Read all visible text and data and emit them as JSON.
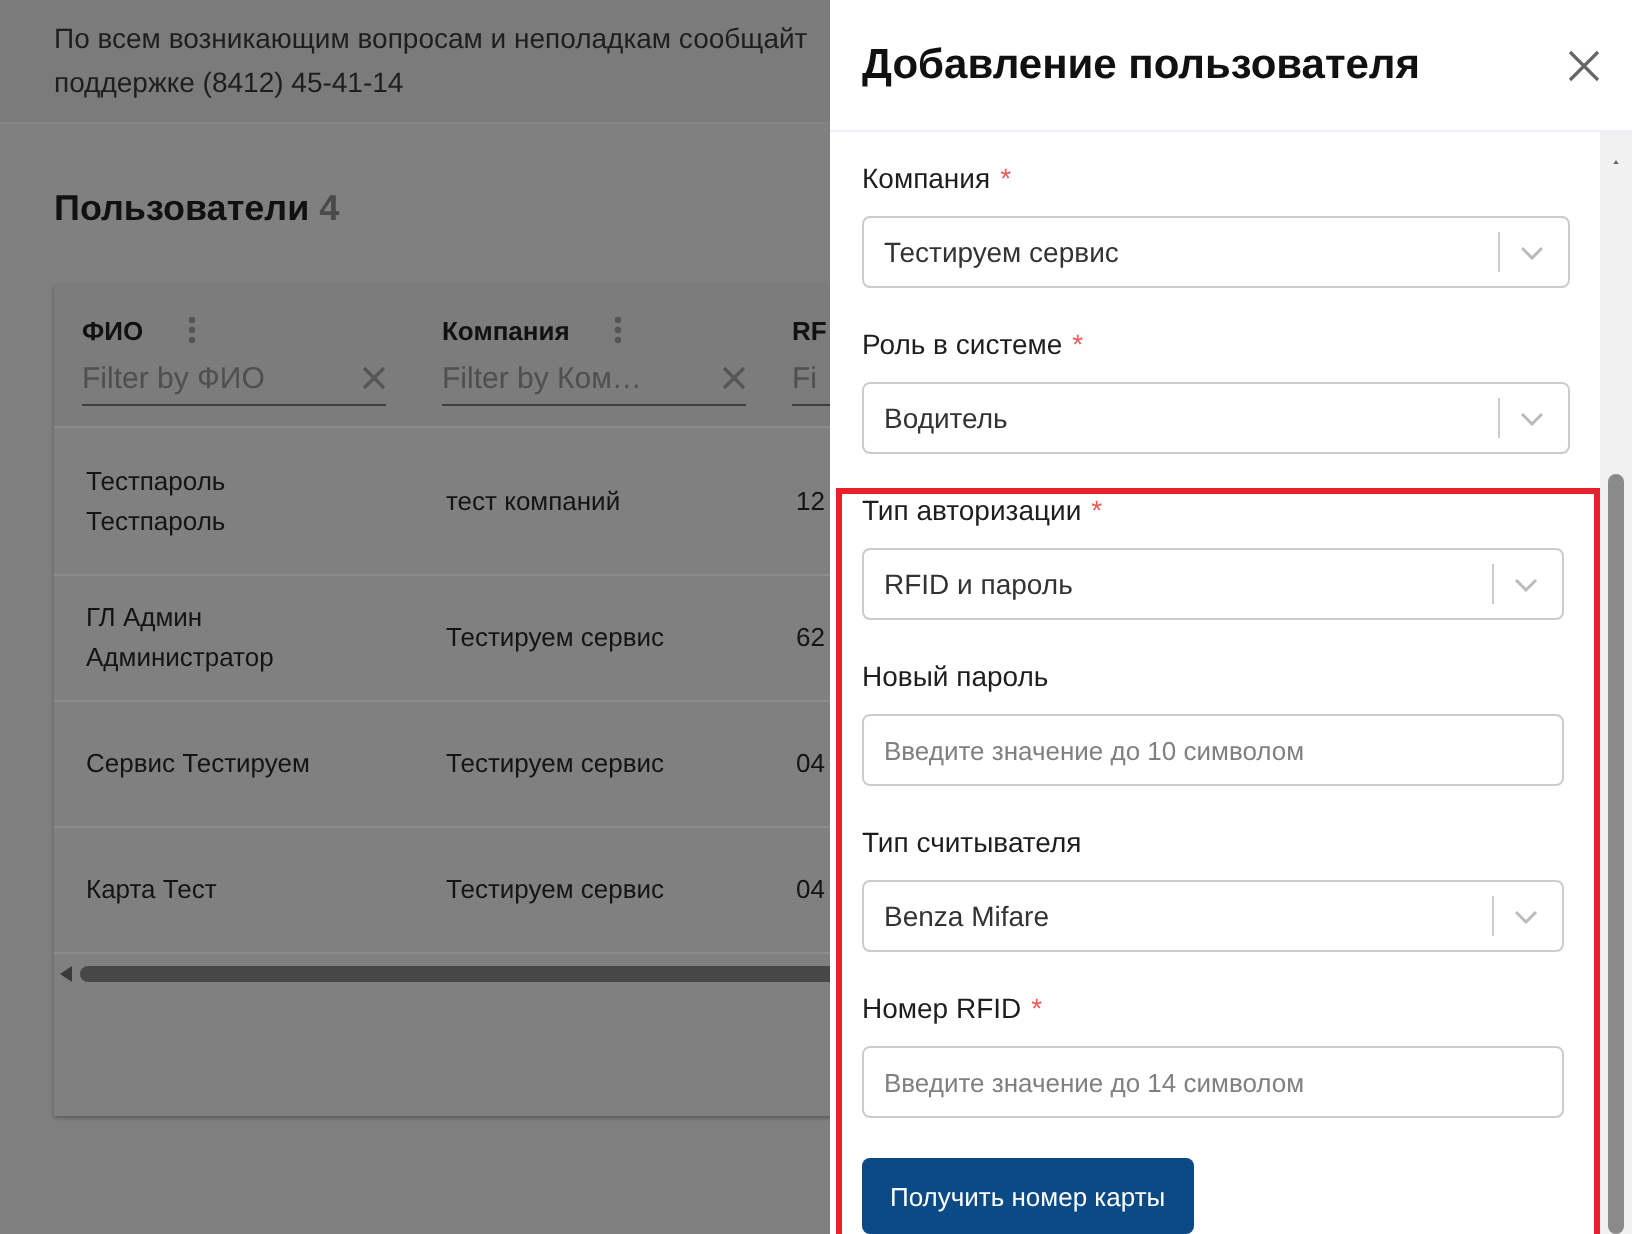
{
  "notice": {
    "lines": [
      "По всем возникающим вопросам и неполадкам сообщайт",
      "поддержке (8412) 45-41-14"
    ]
  },
  "users": {
    "title": "Пользователи",
    "count": "4",
    "columns": [
      {
        "label": "ФИО",
        "filter_placeholder": "Filter by ФИО",
        "menu": true
      },
      {
        "label": "Компания",
        "filter_placeholder": "Filter by Ком…",
        "menu": true
      },
      {
        "label": "RF",
        "filter_placeholder": "Fi",
        "menu": false
      }
    ],
    "rows": [
      [
        "Тестпароль Тестпароль",
        "тест компаний",
        "12"
      ],
      [
        "ГЛ Админ Администратор",
        "Тестируем сервис",
        "62"
      ],
      [
        "Сервис Тестируем",
        "Тестируем сервис",
        "04"
      ],
      [
        "Карта Тест",
        "Тестируем сервис",
        "04"
      ]
    ]
  },
  "drawer": {
    "title": "Добавление пользователя",
    "fields": [
      {
        "kind": "select",
        "label": "Компания",
        "required_mark": "*",
        "value": "Тестируем сервис"
      },
      {
        "kind": "select",
        "label": "Роль в системе",
        "required_mark": "*",
        "value": "Водитель"
      }
    ],
    "highlight_frame": {
      "fields": [
        {
          "kind": "select",
          "label": "Тип авторизации",
          "required_mark": "*",
          "value": "RFID и пароль"
        },
        {
          "kind": "input",
          "label": "Новый пароль",
          "placeholder": "Введите значение до 10 символом"
        },
        {
          "kind": "select",
          "label": "Тип считывателя",
          "value": "Benza Mifare"
        },
        {
          "kind": "input",
          "label": "Номер RFID",
          "required_mark": "*",
          "placeholder": "Введите значение до 14 символом"
        },
        {
          "kind": "button",
          "label": "Получить номер карты"
        }
      ]
    }
  }
}
